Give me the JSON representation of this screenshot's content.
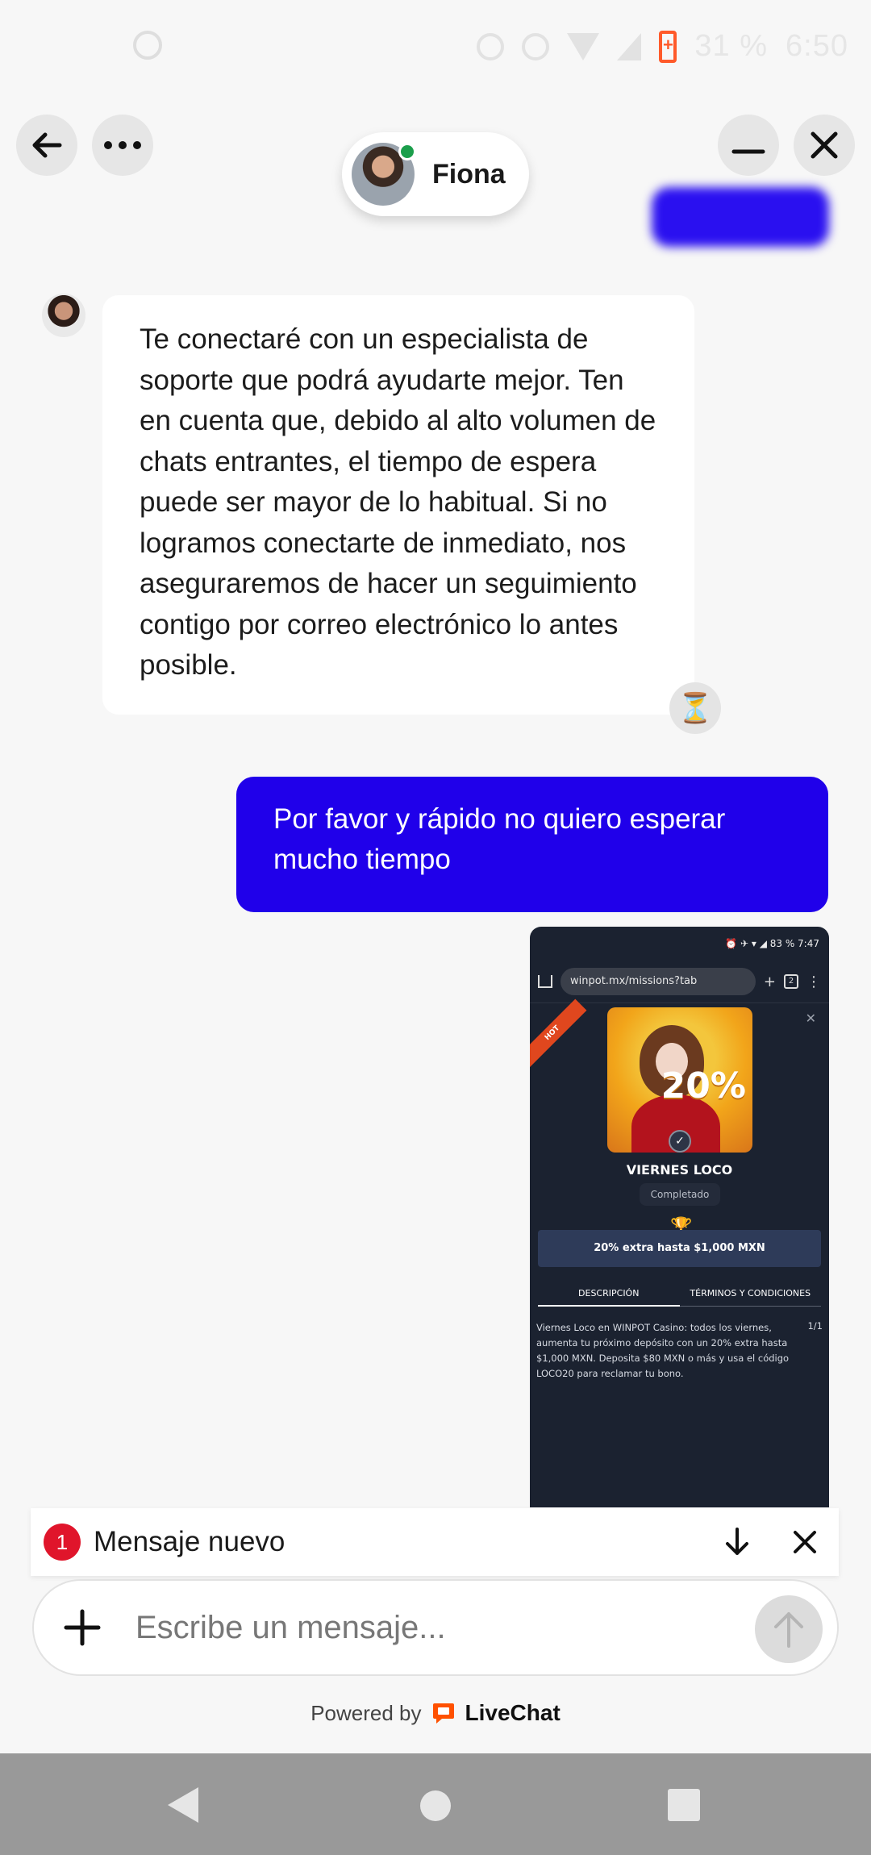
{
  "status_bar": {
    "battery_text": "31 %",
    "time": "6:50"
  },
  "header": {
    "agent_name": "Fiona"
  },
  "messages": {
    "agent_text": "Te conectaré con un especialista de soporte que podrá ayudarte mejor. Ten en cuenta que, debido al alto volumen de chats entrantes, el tiempo de espera puede ser mayor de lo habitual. Si no logramos conectarte de inmediato, nos aseguraremos de hacer un seguimiento contigo por correo electrónico lo antes posible.",
    "user_text": "Por favor y rápido no quiero esperar mucho tiempo"
  },
  "attachment": {
    "status_time": "⏰ ✈ ▾ ◢ 83 % 7:47",
    "url": "winpot.mx/missions?tab",
    "tabs_count": "2",
    "hot_label": "HOT",
    "promo_percent": "20%",
    "title": "VIERNES LOCO",
    "status": "Completado",
    "bonus": "20% extra hasta $1,000 MXN",
    "tab_description": "DESCRIPCIÓN",
    "tab_terms": "TÉRMINOS Y CONDICIONES",
    "description": "Viernes Loco en WINPOT Casino: todos los viernes, aumenta tu próximo depósito con un 20% extra hasta $1,000 MXN. Deposita $80 MXN o más y usa el código LOCO20 para reclamar tu bono.",
    "page": "1/1"
  },
  "new_message_bar": {
    "count": "1",
    "label": "Mensaje nuevo"
  },
  "composer": {
    "placeholder": "Escribe un mensaje..."
  },
  "footer": {
    "powered_by": "Powered by",
    "brand": "LiveChat"
  },
  "colors": {
    "accent": "#2000ea",
    "badge": "#e0152b",
    "livechat": "#ff5100"
  }
}
